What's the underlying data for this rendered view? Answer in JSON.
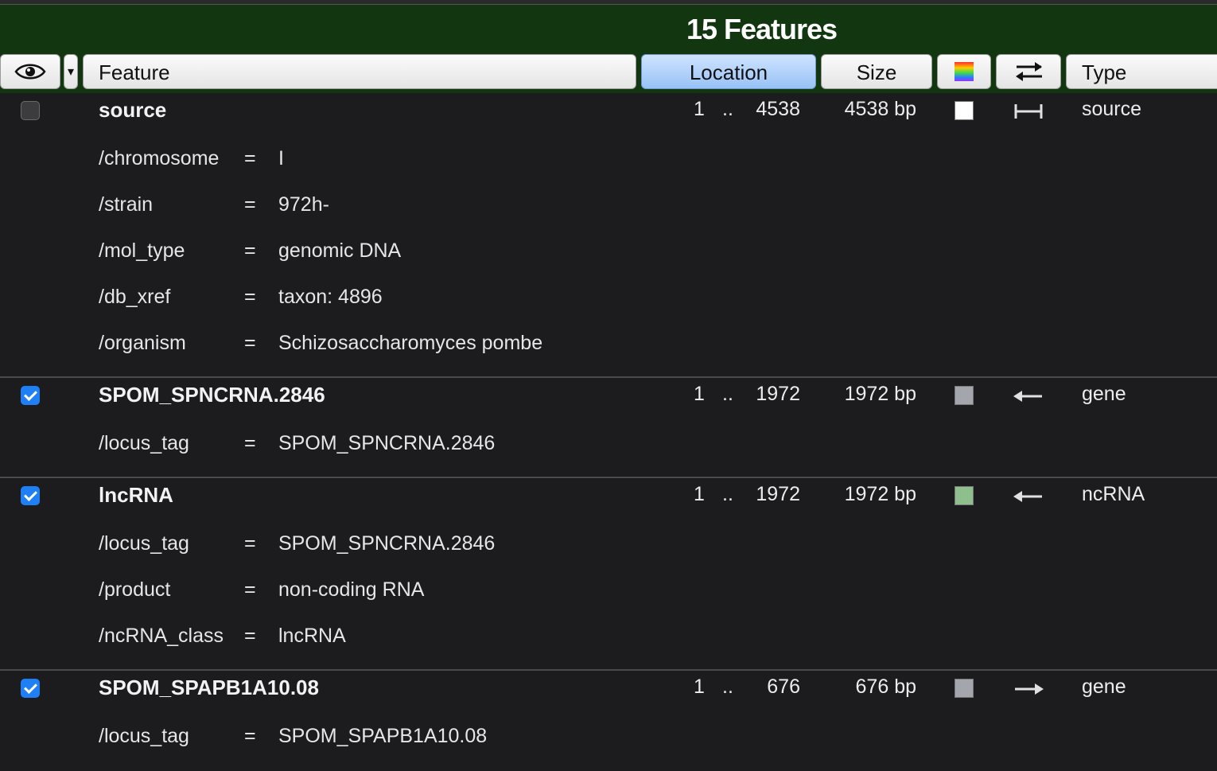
{
  "title": "15 Features",
  "columns": {
    "visibility_menu": "▾",
    "feature": "Feature",
    "location": "Location",
    "size": "Size",
    "type": "Type"
  },
  "icons": {
    "visibility": "eye-icon",
    "color": "color-palette-icon",
    "direction": "swap-arrows-icon"
  },
  "features": [
    {
      "checked": false,
      "name": "source",
      "start": "1",
      "sep": "..",
      "end": "4538",
      "size": "4538 bp",
      "color": "#ffffff",
      "direction": "both",
      "type": "source",
      "qualifiers": [
        {
          "key": "/chromosome",
          "eq": "=",
          "value": "I"
        },
        {
          "key": "/strain",
          "eq": "=",
          "value": "972h-"
        },
        {
          "key": "/mol_type",
          "eq": "=",
          "value": "genomic DNA"
        },
        {
          "key": "/db_xref",
          "eq": "=",
          "value": "taxon: 4896"
        },
        {
          "key": "/organism",
          "eq": "=",
          "value": "Schizosaccharomyces pombe"
        }
      ]
    },
    {
      "checked": true,
      "name": "SPOM_SPNCRNA.2846",
      "start": "1",
      "sep": "..",
      "end": "1972",
      "size": "1972 bp",
      "color": "#a4a6ad",
      "direction": "reverse",
      "type": "gene",
      "qualifiers": [
        {
          "key": "/locus_tag",
          "eq": "=",
          "value": "SPOM_SPNCRNA.2846"
        }
      ]
    },
    {
      "checked": true,
      "name": "lncRNA",
      "start": "1",
      "sep": "..",
      "end": "1972",
      "size": "1972 bp",
      "color": "#8fbf8c",
      "direction": "reverse",
      "type": "ncRNA",
      "qualifiers": [
        {
          "key": "/locus_tag",
          "eq": "=",
          "value": "SPOM_SPNCRNA.2846"
        },
        {
          "key": "/product",
          "eq": "=",
          "value": "non-coding RNA"
        },
        {
          "key": "/ncRNA_class",
          "eq": "=",
          "value": "lncRNA"
        }
      ]
    },
    {
      "checked": true,
      "name": "SPOM_SPAPB1A10.08",
      "start": "1",
      "sep": "..",
      "end": "676",
      "size": "676 bp",
      "color": "#a4a6ad",
      "direction": "forward",
      "type": "gene",
      "qualifiers": [
        {
          "key": "/locus_tag",
          "eq": "=",
          "value": "SPOM_SPAPB1A10.08"
        }
      ]
    }
  ]
}
